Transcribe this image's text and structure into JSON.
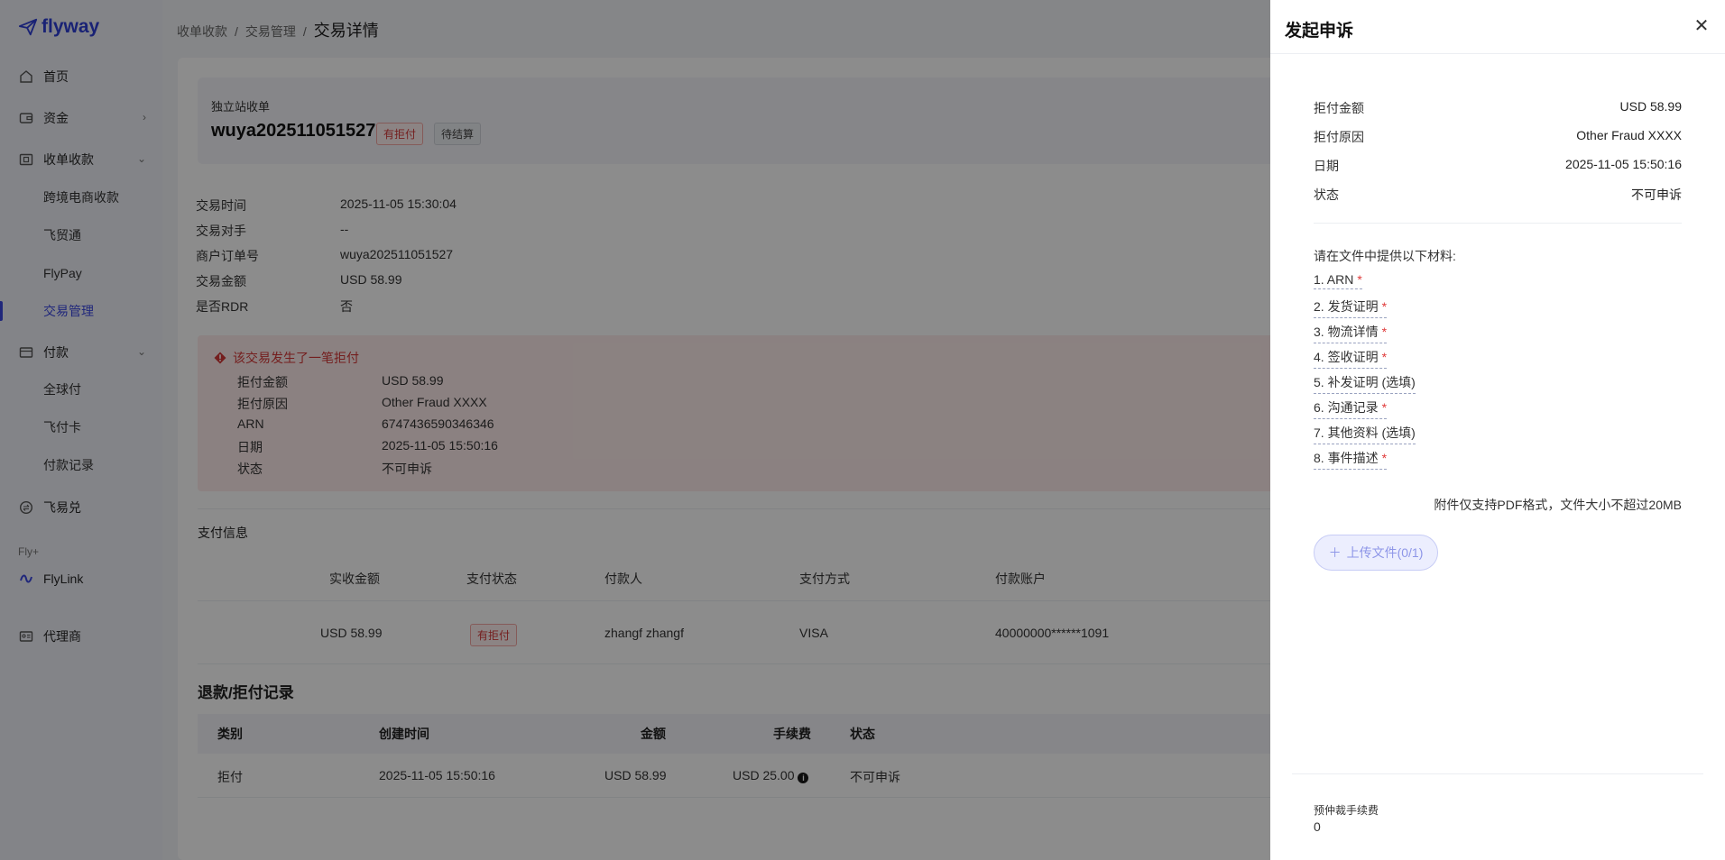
{
  "sidebar": {
    "logo": "flyway",
    "items": [
      {
        "label": "首页",
        "icon": "home-icon"
      },
      {
        "label": "资金",
        "icon": "wallet-icon"
      },
      {
        "label": "收单收款",
        "icon": "receipt-icon"
      },
      {
        "label": "跨境电商收款"
      },
      {
        "label": "飞贸通"
      },
      {
        "label": "FlyPay"
      },
      {
        "label": "交易管理"
      },
      {
        "label": "付款",
        "icon": "card-icon"
      },
      {
        "label": "全球付"
      },
      {
        "label": "飞付卡"
      },
      {
        "label": "付款记录"
      },
      {
        "label": "飞易兑",
        "icon": "exchange-icon"
      },
      {
        "label": "FlyLink",
        "icon": "link-icon"
      },
      {
        "label": "代理商",
        "icon": "agent-icon"
      }
    ],
    "group_label": "Fly+",
    "active_item": "交易管理"
  },
  "breadcrumb": {
    "items": [
      "收单收款",
      "交易管理"
    ],
    "separator": "/",
    "current": "交易详情"
  },
  "header": {
    "type": "独立站收单",
    "order_no": "wuya202511051527",
    "tags": [
      "有拒付",
      "待结算"
    ]
  },
  "details": [
    {
      "label": "交易时间",
      "value": "2025-11-05 15:30:04"
    },
    {
      "label": "交易对手",
      "value": "--"
    },
    {
      "label": "商户订单号",
      "value": "wuya202511051527"
    },
    {
      "label": "交易金额",
      "value": "USD 58.99"
    },
    {
      "label": "是否RDR",
      "value": "否"
    }
  ],
  "alert": {
    "title": "该交易发生了一笔拒付",
    "rows": [
      {
        "label": "拒付金额",
        "value": "USD 58.99"
      },
      {
        "label": "拒付原因",
        "value": "Other Fraud XXXX"
      },
      {
        "label": "ARN",
        "value": "6747436590346346"
      },
      {
        "label": "日期",
        "value": "2025-11-05 15:50:16"
      },
      {
        "label": "状态",
        "value": "不可申诉"
      }
    ]
  },
  "payment": {
    "title": "支付信息",
    "headers": [
      "实收金额",
      "支付状态",
      "付款人",
      "支付方式",
      "付款账户"
    ],
    "row": [
      "USD 58.99",
      "有拒付",
      "zhangf zhangf",
      "VISA",
      "40000000******1091"
    ]
  },
  "records": {
    "title": "退款/拒付记录",
    "headers": [
      "类别",
      "创建时间",
      "金额",
      "手续费",
      "状态"
    ],
    "row": [
      "拒付",
      "2025-11-05 15:50:16",
      "USD 58.99",
      "USD 25.00",
      "不可申诉"
    ]
  },
  "drawer": {
    "title": "发起申诉",
    "summary": [
      {
        "label": "拒付金额",
        "value": "USD 58.99"
      },
      {
        "label": "拒付原因",
        "value": "Other Fraud XXXX"
      },
      {
        "label": "日期",
        "value": "2025-11-05 15:50:16"
      },
      {
        "label": "状态",
        "value": "不可申诉"
      }
    ],
    "intro": "请在文件中提供以下材料:",
    "materials": [
      {
        "text": "1. ARN",
        "required": true
      },
      {
        "text": "2. 发货证明",
        "required": true
      },
      {
        "text": "3. 物流详情",
        "required": true
      },
      {
        "text": "4. 签收证明",
        "required": true
      },
      {
        "text": "5. 补发证明 (选填)",
        "required": false
      },
      {
        "text": "6. 沟通记录",
        "required": true
      },
      {
        "text": "7. 其他资料 (选填)",
        "required": false
      },
      {
        "text": "8. 事件描述",
        "required": true
      }
    ],
    "required_mark": "*",
    "note": "附件仅支持PDF格式，文件大小不超过20MB",
    "upload_label": "上传文件(0/1)",
    "fee_label": "预仲裁手续费",
    "fee_value": "0"
  },
  "colors": {
    "primary": "#3b47e0",
    "danger": "#d43838",
    "overlay": "rgba(0,0,0,0.45)"
  }
}
